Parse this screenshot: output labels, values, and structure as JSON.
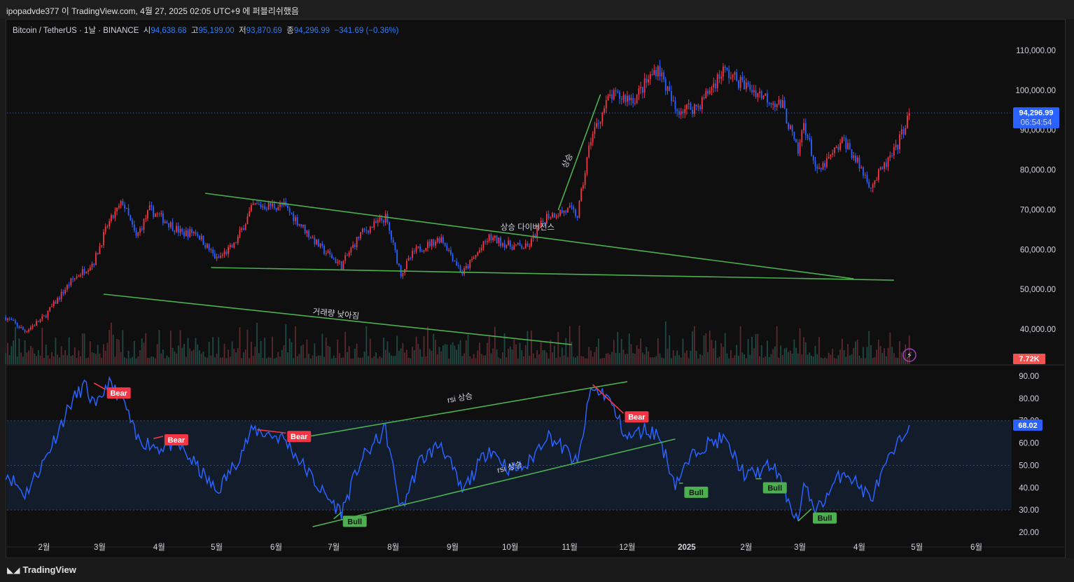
{
  "header": {
    "published": "ipopadvde377 이 TradingView.com, 4월 27, 2025 02:05 UTC+9 에 퍼블리쉬했음"
  },
  "legend": {
    "symbol": "Bitcoin / TetherUS · 1날 · BINANCE",
    "o_label": "시",
    "o": "94,638.68",
    "h_label": "고",
    "h": "95,199.00",
    "l_label": "저",
    "l": "93,870.69",
    "c_label": "종",
    "c": "94,296.99",
    "change": "−341.69 (−0.36%)"
  },
  "footer": {
    "brand": "TradingView"
  },
  "colors": {
    "up": "#f23645",
    "down": "#2962ff",
    "price_line": "#2962ff",
    "rsi": "#2962ff",
    "annotation": "#4caf50",
    "bear": "#f23645",
    "bull": "#4caf50",
    "background": "#0f0f0f"
  },
  "chart_data": [
    {
      "type": "candlestick",
      "pane": "price",
      "y_ticks": [
        "110,000.00",
        "100,000.00",
        "90,000.00",
        "80,000.00",
        "70,000.00",
        "60,000.00",
        "50,000.00",
        "40,000.00"
      ],
      "y_tick_values": [
        110000,
        100000,
        90000,
        80000,
        70000,
        60000,
        50000,
        40000
      ],
      "x_ticks": [
        "2월",
        "3월",
        "4월",
        "5월",
        "6월",
        "7월",
        "8월",
        "9월",
        "10월",
        "11월",
        "12월",
        "2025",
        "2월",
        "3월",
        "4월",
        "5월",
        "6월"
      ],
      "x_tick_dates": [
        "2024-02-01",
        "2024-03-01",
        "2024-04-01",
        "2024-05-01",
        "2024-06-01",
        "2024-07-01",
        "2024-08-01",
        "2024-09-01",
        "2024-10-01",
        "2024-11-01",
        "2024-12-01",
        "2025-01-01",
        "2025-02-01",
        "2025-03-01",
        "2025-04-01",
        "2025-05-01",
        "2025-06-01"
      ],
      "last_price": "94,296.99",
      "last_price_value": 94296.99,
      "countdown": "06:54:54",
      "volume_last": "7.72K",
      "close_keypoints": [
        [
          "2024-01-12",
          43000
        ],
        [
          "2024-01-22",
          39500
        ],
        [
          "2024-02-01",
          43000
        ],
        [
          "2024-02-15",
          52000
        ],
        [
          "2024-02-27",
          57000
        ],
        [
          "2024-03-05",
          66000
        ],
        [
          "2024-03-13",
          72000
        ],
        [
          "2024-03-20",
          63000
        ],
        [
          "2024-03-27",
          70000
        ],
        [
          "2024-04-05",
          67000
        ],
        [
          "2024-04-13",
          64000
        ],
        [
          "2024-04-20",
          64500
        ],
        [
          "2024-05-01",
          57500
        ],
        [
          "2024-05-10",
          61000
        ],
        [
          "2024-05-20",
          71000
        ],
        [
          "2024-06-05",
          71000
        ],
        [
          "2024-06-24",
          60500
        ],
        [
          "2024-07-05",
          56000
        ],
        [
          "2024-07-15",
          64000
        ],
        [
          "2024-07-28",
          68000
        ],
        [
          "2024-08-05",
          54000
        ],
        [
          "2024-08-12",
          59500
        ],
        [
          "2024-08-26",
          63000
        ],
        [
          "2024-09-06",
          54000
        ],
        [
          "2024-09-20",
          63000
        ],
        [
          "2024-10-01",
          61000
        ],
        [
          "2024-10-10",
          60500
        ],
        [
          "2024-10-20",
          68500
        ],
        [
          "2024-11-01",
          70000
        ],
        [
          "2024-11-05",
          68500
        ],
        [
          "2024-11-12",
          88000
        ],
        [
          "2024-11-22",
          98500
        ],
        [
          "2024-12-05",
          98000
        ],
        [
          "2024-12-17",
          106000
        ],
        [
          "2024-12-26",
          95000
        ],
        [
          "2025-01-07",
          96000
        ],
        [
          "2025-01-20",
          105000
        ],
        [
          "2025-02-01",
          101000
        ],
        [
          "2025-02-20",
          96000
        ],
        [
          "2025-02-28",
          84000
        ],
        [
          "2025-03-03",
          92000
        ],
        [
          "2025-03-10",
          79000
        ],
        [
          "2025-03-24",
          87500
        ],
        [
          "2025-04-07",
          76000
        ],
        [
          "2025-04-20",
          85000
        ],
        [
          "2025-04-27",
          94296.99
        ]
      ],
      "trendlines": [
        {
          "from": [
            "2024-04-25",
            74120
          ],
          "to": [
            "2025-03-29",
            52660
          ]
        },
        {
          "from": [
            "2024-04-28",
            55480
          ],
          "to": [
            "2025-04-19",
            52300
          ]
        },
        {
          "from": [
            "2024-03-03",
            48800
          ],
          "to": [
            "2024-11-02",
            36130
          ]
        },
        {
          "from": [
            "2024-10-26",
            69900
          ],
          "to": [
            "2024-11-17",
            98920
          ]
        }
      ],
      "annotations": [
        {
          "text": "상승 다이버전스",
          "at": [
            "2024-10-10",
            65000
          ]
        },
        {
          "text": "상승",
          "at": [
            "2024-11-01",
            82000
          ],
          "rotate": -65
        },
        {
          "text": "거래량 낮아짐",
          "at": [
            "2024-07-02",
            43200
          ],
          "rotate": 6
        }
      ]
    },
    {
      "type": "line",
      "pane": "rsi",
      "y_ticks": [
        "90.00",
        "80.00",
        "70.00",
        "60.00",
        "50.00",
        "40.00",
        "30.00",
        "20.00"
      ],
      "y_tick_values": [
        90,
        80,
        70,
        60,
        50,
        40,
        30,
        20
      ],
      "ylim": [
        20,
        90
      ],
      "band": [
        30,
        70
      ],
      "midline": 50,
      "last_value": "68.02",
      "last_value_number": 68.02,
      "keypoints": [
        [
          "2024-01-12",
          47
        ],
        [
          "2024-01-22",
          37
        ],
        [
          "2024-02-01",
          52
        ],
        [
          "2024-02-15",
          78
        ],
        [
          "2024-02-22",
          86
        ],
        [
          "2024-02-28",
          75
        ],
        [
          "2024-03-05",
          87
        ],
        [
          "2024-03-13",
          80
        ],
        [
          "2024-03-20",
          62
        ],
        [
          "2024-04-01",
          58
        ],
        [
          "2024-04-10",
          60
        ],
        [
          "2024-04-20",
          50
        ],
        [
          "2024-05-01",
          38
        ],
        [
          "2024-05-10",
          50
        ],
        [
          "2024-05-20",
          66
        ],
        [
          "2024-06-05",
          62
        ],
        [
          "2024-06-15",
          50
        ],
        [
          "2024-06-25",
          38
        ],
        [
          "2024-07-05",
          29
        ],
        [
          "2024-07-15",
          52
        ],
        [
          "2024-07-28",
          66
        ],
        [
          "2024-08-05",
          30
        ],
        [
          "2024-08-15",
          52
        ],
        [
          "2024-08-26",
          60
        ],
        [
          "2024-09-06",
          38
        ],
        [
          "2024-09-20",
          58
        ],
        [
          "2024-10-01",
          48
        ],
        [
          "2024-10-10",
          50
        ],
        [
          "2024-10-20",
          64
        ],
        [
          "2024-11-01",
          55
        ],
        [
          "2024-11-05",
          50
        ],
        [
          "2024-11-12",
          84
        ],
        [
          "2024-11-20",
          82
        ],
        [
          "2024-12-01",
          62
        ],
        [
          "2024-12-10",
          66
        ],
        [
          "2024-12-17",
          64
        ],
        [
          "2024-12-26",
          42
        ],
        [
          "2025-01-07",
          58
        ],
        [
          "2025-01-20",
          62
        ],
        [
          "2025-02-01",
          45
        ],
        [
          "2025-02-15",
          50
        ],
        [
          "2025-02-28",
          25
        ],
        [
          "2025-03-03",
          40
        ],
        [
          "2025-03-10",
          30
        ],
        [
          "2025-03-24",
          48
        ],
        [
          "2025-04-07",
          35
        ],
        [
          "2025-04-15",
          50
        ],
        [
          "2025-04-27",
          68.02
        ]
      ],
      "trendlines": [
        {
          "from": [
            "2024-06-10",
            61.8
          ],
          "to": [
            "2024-12-01",
            87.5
          ]
        },
        {
          "from": [
            "2024-06-20",
            22.5
          ],
          "to": [
            "2024-12-26",
            61.8
          ]
        }
      ],
      "annotations": [
        {
          "text": "rsi 상승",
          "at": [
            "2024-09-05",
            79
          ],
          "rotate": -10
        },
        {
          "text": "rsi 상승",
          "at": [
            "2024-10-01",
            48
          ],
          "rotate": -14
        }
      ],
      "divergences": [
        {
          "label": "Bear",
          "from": [
            "2024-02-27",
            86.9
          ],
          "to": [
            "2024-03-04",
            84.0
          ]
        },
        {
          "label": "Bear",
          "from": [
            "2024-03-29",
            62
          ],
          "to": [
            "2024-04-03",
            63
          ]
        },
        {
          "label": "Bear",
          "from": [
            "2024-05-22",
            66
          ],
          "to": [
            "2024-06-06",
            64.5
          ]
        },
        {
          "label": "Bear",
          "from": [
            "2024-11-13",
            86.2
          ],
          "to": [
            "2024-11-29",
            73.3
          ]
        },
        {
          "label": "Bull",
          "from": [
            "2024-07-01",
            26
          ],
          "to": [
            "2024-07-05",
            29
          ]
        },
        {
          "label": "Bull",
          "from": [
            "2024-12-28",
            42
          ],
          "to": [
            "2024-12-30",
            42
          ]
        },
        {
          "label": "Bull",
          "from": [
            "2025-02-06",
            44
          ],
          "to": [
            "2025-02-09",
            44
          ]
        },
        {
          "label": "Bull",
          "from": [
            "2025-02-28",
            25
          ],
          "to": [
            "2025-03-07",
            30.5
          ]
        }
      ]
    }
  ]
}
